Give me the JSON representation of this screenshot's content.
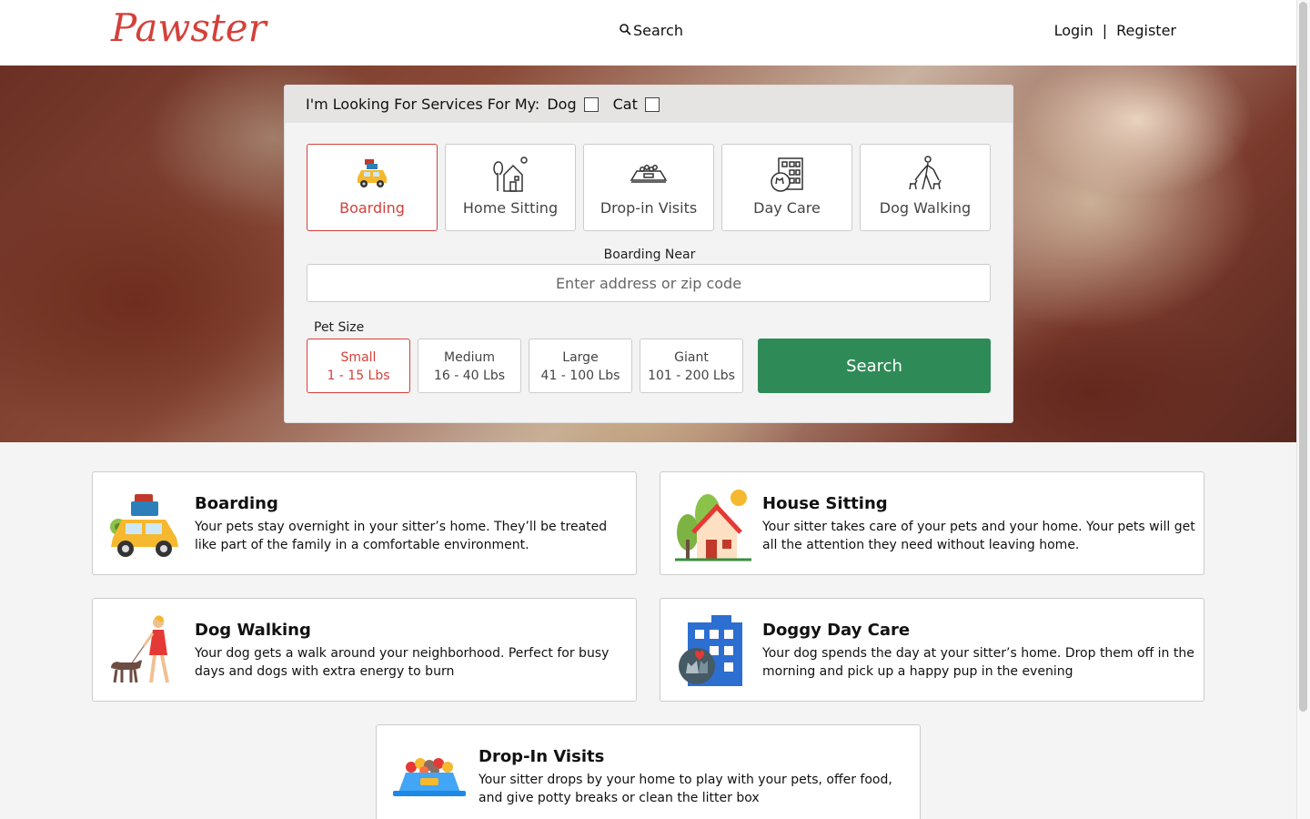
{
  "header": {
    "logo": "Pawster",
    "search_label": "Search",
    "login_label": "Login",
    "separator": "|",
    "register_label": "Register"
  },
  "search_card": {
    "looking_for_label": "I'm Looking For Services For My:",
    "pet_dog_label": "Dog",
    "pet_cat_label": "Cat",
    "services": [
      {
        "label": "Boarding",
        "icon": "car-with-luggage-icon",
        "active": true
      },
      {
        "label": "Home Sitting",
        "icon": "house-with-trees-icon",
        "active": false
      },
      {
        "label": "Drop-in Visits",
        "icon": "food-bowl-icon",
        "active": false
      },
      {
        "label": "Day Care",
        "icon": "building-with-pets-icon",
        "active": false
      },
      {
        "label": "Dog Walking",
        "icon": "person-walking-dogs-icon",
        "active": false
      }
    ],
    "near_label": "Boarding Near",
    "address_placeholder": "Enter address or zip code",
    "pet_size_label": "Pet Size",
    "sizes": [
      {
        "name": "Small",
        "range": "1 - 15 Lbs",
        "active": true
      },
      {
        "name": "Medium",
        "range": "16 - 40 Lbs",
        "active": false
      },
      {
        "name": "Large",
        "range": "41 - 100 Lbs",
        "active": false
      },
      {
        "name": "Giant",
        "range": "101 - 200 Lbs",
        "active": false
      }
    ],
    "search_button": "Search"
  },
  "info_cards": [
    {
      "title": "Boarding",
      "text": "Your pets stay overnight in your sitter’s home. They’ll be treated like part of the family in a comfortable environment.",
      "icon": "car-with-luggage-icon"
    },
    {
      "title": "House Sitting",
      "text": "Your sitter takes care of your pets and your home. Your pets will get all the attention they need without leaving home.",
      "icon": "house-with-trees-icon"
    },
    {
      "title": "Dog Walking",
      "text": "Your dog gets a walk around your neighborhood. Perfect for busy days and dogs with extra energy to burn",
      "icon": "person-walking-dog-icon"
    },
    {
      "title": "Doggy Day Care",
      "text": "Your dog spends the day at your sitter’s home. Drop them off in the morning and pick up a happy pup in the evening",
      "icon": "building-with-pets-icon"
    },
    {
      "title": "Drop-In Visits",
      "text": "Your sitter drops by your home to play with your pets, offer food, and give potty breaks or clean the litter box",
      "icon": "food-bowl-icon"
    }
  ],
  "colors": {
    "brand": "#d4403a",
    "search_button": "#2e8b57"
  }
}
